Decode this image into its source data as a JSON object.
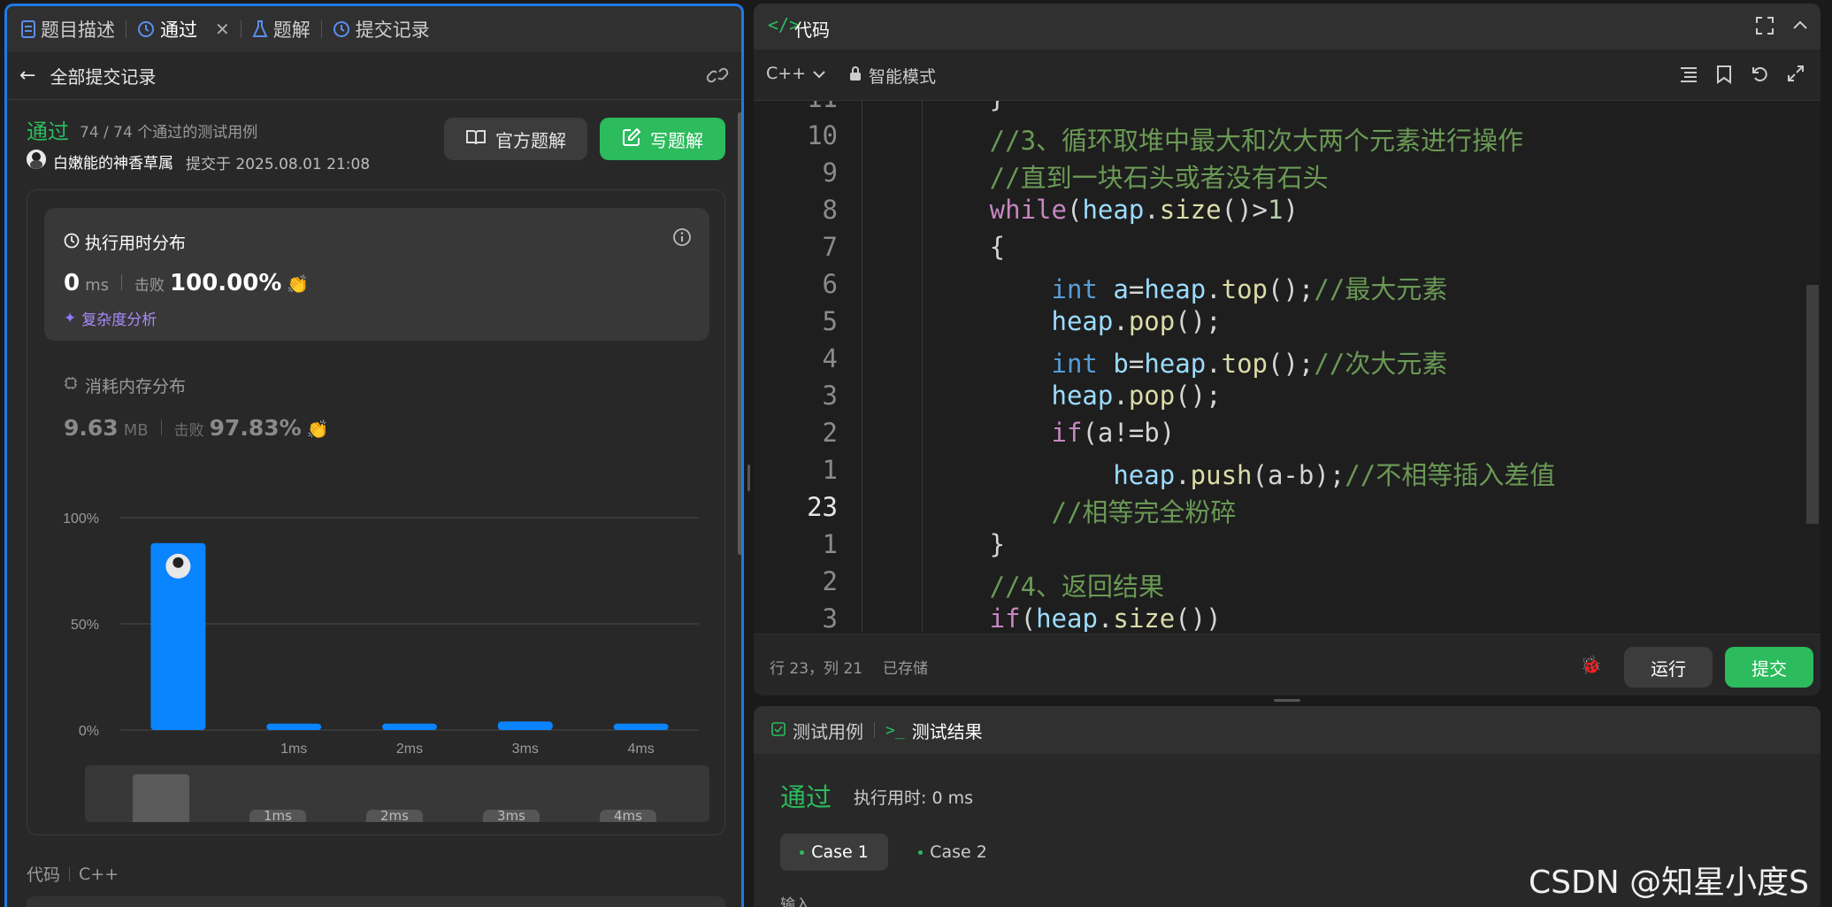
{
  "left_tabs": {
    "description": "题目描述",
    "passed": "通过",
    "solutions": "题解",
    "submissions": "提交记录"
  },
  "subheader": {
    "back_label": "全部提交记录"
  },
  "result": {
    "status": "通过",
    "testcases": "74 / 74 个通过的测试用例",
    "user": "白嫩能的神香草属",
    "submitted_at": "提交于 2025.08.01 21:08",
    "official_solution_label": "官方题解",
    "write_solution_label": "写题解"
  },
  "runtime": {
    "title": "执行用时分布",
    "value": "0",
    "unit": "ms",
    "beats_label": "击败",
    "beats": "100.00%",
    "complexity_label": "复杂度分析"
  },
  "memory": {
    "title": "消耗内存分布",
    "value": "9.63",
    "unit": "MB",
    "beats_label": "击败",
    "beats": "97.83%"
  },
  "chart_data": {
    "type": "bar",
    "categories": [
      "0ms",
      "1ms",
      "2ms",
      "3ms",
      "4ms"
    ],
    "values": [
      88,
      3,
      3,
      4,
      3
    ],
    "ylim": [
      0,
      100
    ],
    "yticks": [
      "100%",
      "50%",
      "0%"
    ],
    "xtick_labels": [
      "",
      "1ms",
      "2ms",
      "3ms",
      "4ms"
    ],
    "bar_color": "#0a84ff",
    "minimap_labels": [
      "1ms",
      "2ms",
      "3ms",
      "4ms"
    ]
  },
  "code_footer": {
    "label": "代码",
    "lang": "C++"
  },
  "editor": {
    "title": "代码",
    "language": "C++",
    "mode": "智能模式",
    "lines": [
      {
        "n": "11",
        "code": [
          [
            "pn",
            "        }"
          ]
        ]
      },
      {
        "n": "10",
        "code": [
          [
            "cm",
            "        //3、循环取堆中最大和次大两个元素进行操作"
          ]
        ]
      },
      {
        "n": "9",
        "code": [
          [
            "cm",
            "        //直到一块石头或者没有石头"
          ]
        ]
      },
      {
        "n": "8",
        "code": [
          [
            "kw",
            "        while"
          ],
          [
            "pn",
            "("
          ],
          [
            "vr",
            "heap"
          ],
          [
            "pn",
            "."
          ],
          [
            "fn",
            "size"
          ],
          [
            "pn",
            "()>"
          ],
          [
            "nm",
            "1"
          ],
          [
            "pn",
            ")"
          ]
        ]
      },
      {
        "n": "7",
        "code": [
          [
            "pn",
            "        {"
          ]
        ]
      },
      {
        "n": "6",
        "code": [
          [
            "ty",
            "            int"
          ],
          [
            "pn",
            " "
          ],
          [
            "vr",
            "a"
          ],
          [
            "pn",
            "="
          ],
          [
            "vr",
            "heap"
          ],
          [
            "pn",
            "."
          ],
          [
            "fn",
            "top"
          ],
          [
            "pn",
            "();"
          ],
          [
            "cm",
            "//最大元素"
          ]
        ]
      },
      {
        "n": "5",
        "code": [
          [
            "vr",
            "            heap"
          ],
          [
            "pn",
            "."
          ],
          [
            "fn",
            "pop"
          ],
          [
            "pn",
            "();"
          ]
        ]
      },
      {
        "n": "4",
        "code": [
          [
            "ty",
            "            int"
          ],
          [
            "pn",
            " "
          ],
          [
            "vr",
            "b"
          ],
          [
            "pn",
            "="
          ],
          [
            "vr",
            "heap"
          ],
          [
            "pn",
            "."
          ],
          [
            "fn",
            "top"
          ],
          [
            "pn",
            "();"
          ],
          [
            "cm",
            "//次大元素"
          ]
        ]
      },
      {
        "n": "3",
        "code": [
          [
            "vr",
            "            heap"
          ],
          [
            "pn",
            "."
          ],
          [
            "fn",
            "pop"
          ],
          [
            "pn",
            "();"
          ]
        ]
      },
      {
        "n": "2",
        "code": [
          [
            "kw",
            "            if"
          ],
          [
            "pn",
            "(a!=b)"
          ]
        ]
      },
      {
        "n": "1",
        "code": [
          [
            "vr",
            "                heap"
          ],
          [
            "pn",
            "."
          ],
          [
            "fn",
            "push"
          ],
          [
            "pn",
            "(a-b);"
          ],
          [
            "cm",
            "//不相等插入差值"
          ]
        ]
      },
      {
        "n": "23",
        "code": [
          [
            "cm",
            "            //相等完全粉碎"
          ]
        ]
      },
      {
        "n": "1",
        "code": [
          [
            "pn",
            "        }"
          ]
        ]
      },
      {
        "n": "2",
        "code": [
          [
            "cm",
            "        //4、返回结果"
          ]
        ]
      },
      {
        "n": "3",
        "code": [
          [
            "kw",
            "        if"
          ],
          [
            "pn",
            "("
          ],
          [
            "vr",
            "heap"
          ],
          [
            "pn",
            "."
          ],
          [
            "fn",
            "size"
          ],
          [
            "pn",
            "())"
          ]
        ]
      }
    ],
    "status_position": "行 23，列 21",
    "status_saved": "已存储",
    "run_label": "运行",
    "submit_label": "提交"
  },
  "test_panel": {
    "tab_cases": "测试用例",
    "tab_result": "测试结果",
    "status": "通过",
    "runtime": "执行用时: 0 ms",
    "case1": "Case 1",
    "case2": "Case 2",
    "input_label": "输入"
  },
  "watermark": "CSDN @知星小度S"
}
